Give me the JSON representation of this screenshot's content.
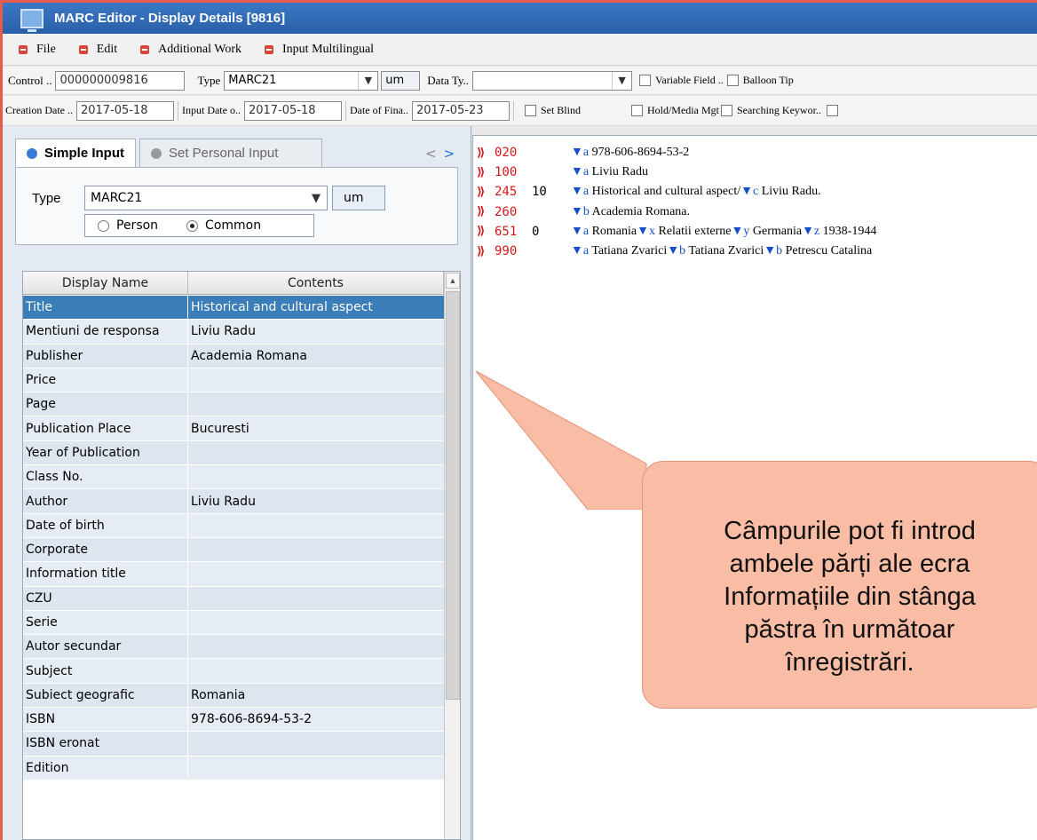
{
  "window": {
    "title": "MARC Editor - Display Details [9816]"
  },
  "menu": [
    {
      "label": "File"
    },
    {
      "label": "Edit"
    },
    {
      "label": "Additional Work"
    },
    {
      "label": "Input Multilingual"
    }
  ],
  "toolbar1": {
    "control_label": "Control ..",
    "control_value": "000000009816",
    "type_label": "Type",
    "type_value": "MARC21",
    "um_value": "um",
    "datatype_label": "Data Ty..",
    "datatype_value": "",
    "variable_field_label": "Variable Field ..",
    "balloon_tip_label": "Balloon Tip"
  },
  "toolbar2": {
    "creation_date_label": "Creation Date ..",
    "creation_date_value": "2017-05-18",
    "input_date_label": "Input Date o..",
    "input_date_value": "2017-05-18",
    "final_date_label": "Date of Fina..",
    "final_date_value": "2017-05-23",
    "set_blind_label": "Set Blind",
    "hold_media_label": "Hold/Media Mgt",
    "searching_keyword_label": "Searching Keywor.."
  },
  "left_panel": {
    "tabs": [
      {
        "label": "Simple Input",
        "active": true
      },
      {
        "label": "Set Personal Input",
        "active": false
      }
    ],
    "type_label": "Type",
    "type_value": "MARC21",
    "um_value": "um",
    "radio_person": "Person",
    "radio_common": "Common",
    "radio_selected": "Common",
    "grid": {
      "headers": [
        "Display Name",
        "Contents"
      ],
      "rows": [
        {
          "name": "Title",
          "content": "Historical and cultural aspect",
          "selected": true
        },
        {
          "name": "Mentiuni de responsa",
          "content": "Liviu Radu"
        },
        {
          "name": "Publisher",
          "content": "Academia Romana"
        },
        {
          "name": "Price",
          "content": ""
        },
        {
          "name": "Page",
          "content": ""
        },
        {
          "name": "Publication Place",
          "content": "Bucuresti"
        },
        {
          "name": "Year of Publication",
          "content": ""
        },
        {
          "name": "Class No.",
          "content": ""
        },
        {
          "name": "Author",
          "content": "Liviu Radu"
        },
        {
          "name": "Date of birth",
          "content": ""
        },
        {
          "name": "Corporate",
          "content": ""
        },
        {
          "name": "Information title",
          "content": ""
        },
        {
          "name": "CZU",
          "content": ""
        },
        {
          "name": "Serie",
          "content": ""
        },
        {
          "name": "Autor secundar",
          "content": ""
        },
        {
          "name": "Subject",
          "content": ""
        },
        {
          "name": "Subiect geografic",
          "content": "Romania"
        },
        {
          "name": "ISBN",
          "content": "978-606-8694-53-2"
        },
        {
          "name": "ISBN eronat",
          "content": ""
        },
        {
          "name": "Edition",
          "content": ""
        }
      ]
    }
  },
  "marc_record": [
    {
      "tag": "020",
      "ind": "",
      "parts": [
        [
          "a",
          "978-606-8694-53-2"
        ]
      ]
    },
    {
      "tag": "100",
      "ind": "",
      "parts": [
        [
          "a",
          "Liviu Radu"
        ]
      ]
    },
    {
      "tag": "245",
      "ind": "10",
      "parts": [
        [
          "a",
          "Historical and cultural aspect/"
        ],
        [
          "c",
          "Liviu Radu."
        ]
      ]
    },
    {
      "tag": "260",
      "ind": "",
      "parts": [
        [
          "b",
          "Academia Romana."
        ]
      ]
    },
    {
      "tag": "651",
      "ind": " 0",
      "parts": [
        [
          "a",
          "Romania"
        ],
        [
          "x",
          "Relatii externe"
        ],
        [
          "y",
          "Germania"
        ],
        [
          "z",
          "1938-1944"
        ]
      ]
    },
    {
      "tag": "990",
      "ind": "",
      "parts": [
        [
          "a",
          "Tatiana Zvarici"
        ],
        [
          "b",
          "Tatiana Zvarici"
        ],
        [
          "b",
          "Petrescu Catalina"
        ]
      ]
    }
  ],
  "callout": {
    "lines": [
      "Câmpurile pot fi introd",
      "ambele părți ale ecra",
      "Informațiile din stânga",
      "păstra în următoar",
      "înregistrări."
    ]
  },
  "colors": {
    "title_bar": "#2a5fa8",
    "selected_row": "#3a7db8",
    "marc_tag": "#d4161b",
    "subfield_code": "#1550c9",
    "callout_fill": "#f9bda5",
    "frame_border": "#e85a4a"
  }
}
